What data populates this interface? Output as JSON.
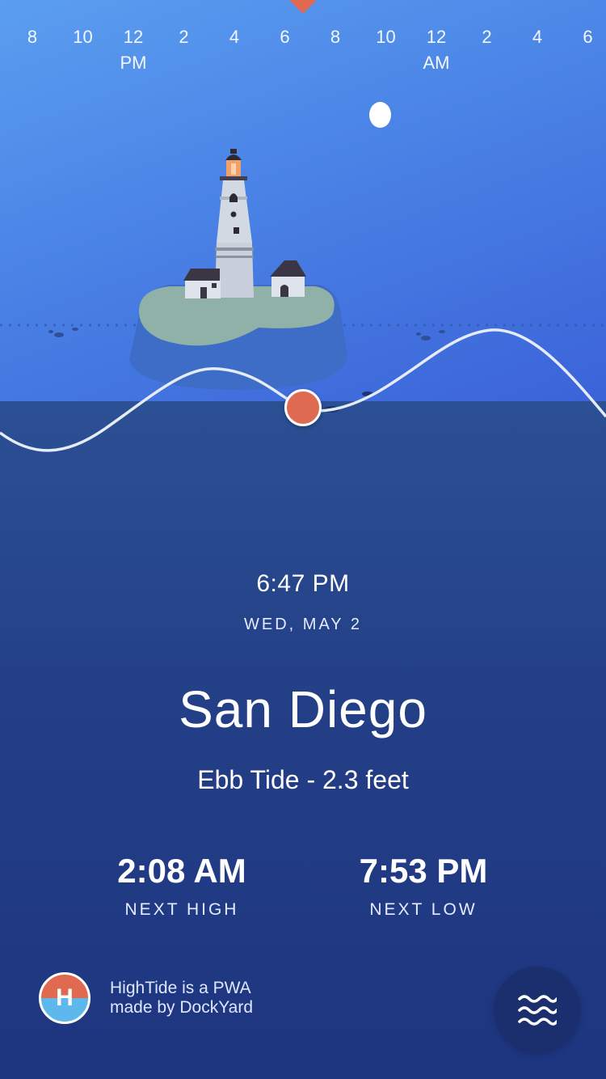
{
  "timeline": {
    "ticks": [
      {
        "label": "8",
        "ampm": ""
      },
      {
        "label": "10",
        "ampm": ""
      },
      {
        "label": "12",
        "ampm": "PM"
      },
      {
        "label": "2",
        "ampm": ""
      },
      {
        "label": "4",
        "ampm": ""
      },
      {
        "label": "6",
        "ampm": ""
      },
      {
        "label": "8",
        "ampm": ""
      },
      {
        "label": "10",
        "ampm": ""
      },
      {
        "label": "12",
        "ampm": "AM"
      },
      {
        "label": "2",
        "ampm": ""
      },
      {
        "label": "4",
        "ampm": ""
      },
      {
        "label": "6",
        "ampm": ""
      }
    ]
  },
  "current": {
    "time": "6:47 PM",
    "date": "WED, MAY 2",
    "city": "San Diego",
    "tide_state": "Ebb Tide - 2.3 feet"
  },
  "next_high": {
    "time": "2:08 AM",
    "label": "NEXT HIGH"
  },
  "next_low": {
    "time": "7:53 PM",
    "label": "NEXT LOW"
  },
  "footer": {
    "logo_letter": "H",
    "credit_line1": "HighTide is a PWA",
    "credit_line2": "made by DockYard"
  },
  "icons": {
    "menu": "waves-icon",
    "moon": "moon-icon",
    "lighthouse": "lighthouse-icon"
  },
  "colors": {
    "accent": "#e0694f",
    "sky": "#4a83e6",
    "sea": "#233f86"
  }
}
